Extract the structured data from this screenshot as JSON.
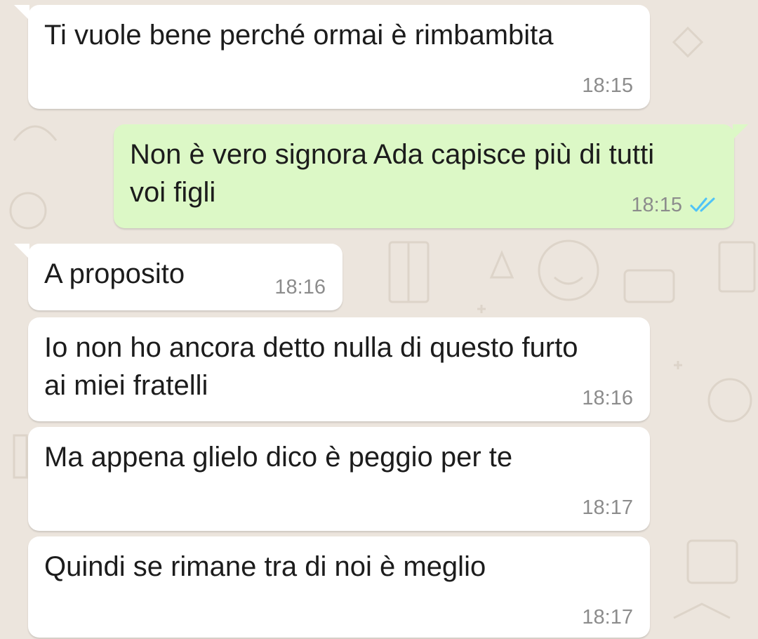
{
  "messages": [
    {
      "direction": "in",
      "text": "Ti vuole bene perché ormai è rimbambita",
      "time": "18:15"
    },
    {
      "direction": "out",
      "text": "Non è vero signora Ada capisce più di tutti\nvoi figli",
      "time": "18:15",
      "status": "read",
      "status_icon": "double-check-icon",
      "status_color": "#4fc3f7"
    },
    {
      "direction": "in",
      "text": "A proposito",
      "time": "18:16"
    },
    {
      "direction": "in",
      "text": "Io non ho ancora detto nulla di questo furto\nai miei fratelli",
      "time": "18:16"
    },
    {
      "direction": "in",
      "text": "Ma appena glielo dico è peggio per te",
      "time": "18:17"
    },
    {
      "direction": "in",
      "text": "Quindi se rimane tra di noi è meglio",
      "time": "18:17"
    }
  ],
  "theme": {
    "background": "#ece5dd",
    "incoming_bubble": "#ffffff",
    "outgoing_bubble": "#dcf8c6",
    "time_color": "#8c8c8c"
  }
}
